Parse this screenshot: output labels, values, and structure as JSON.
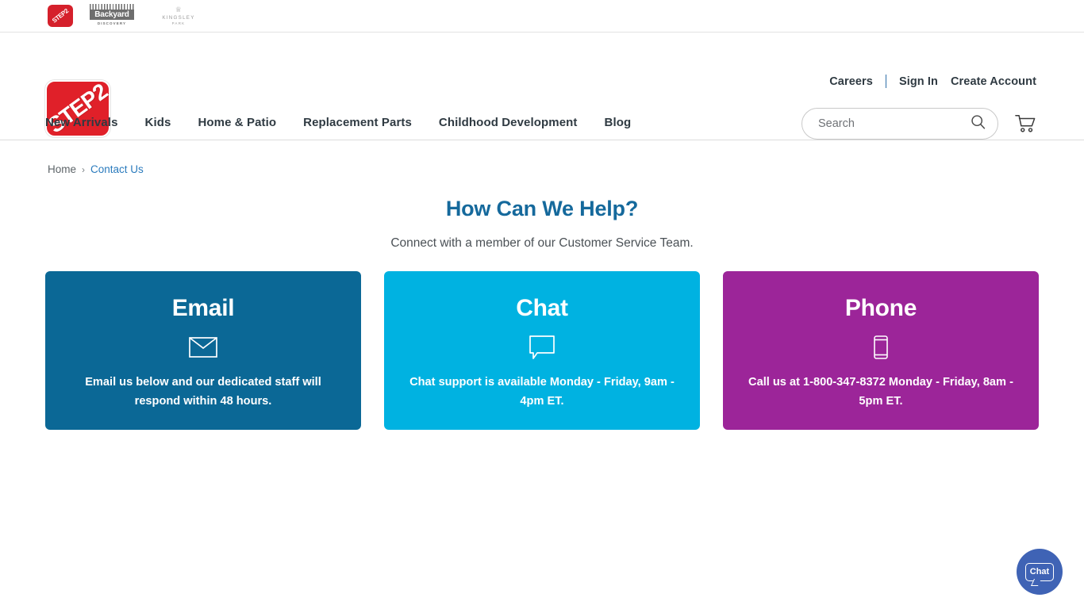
{
  "brandbar": {
    "logos": [
      {
        "name": "step2",
        "text": "STEP2"
      },
      {
        "name": "backyard-discovery",
        "text": "Backyard",
        "sub": "DISCOVERY"
      },
      {
        "name": "kingsley-park",
        "crown": "♕",
        "text": "KINGSLEY",
        "sub": "PARK"
      }
    ]
  },
  "header": {
    "logo_text": "STEP2",
    "utility_links": [
      {
        "label": "Careers"
      },
      {
        "label": "Sign In"
      },
      {
        "label": "Create Account"
      }
    ],
    "search": {
      "placeholder": "Search",
      "value": "",
      "icon": "search-icon"
    },
    "cart": {
      "icon": "shopping-cart-icon"
    },
    "nav": [
      {
        "label": "New Arrivals"
      },
      {
        "label": "Kids"
      },
      {
        "label": "Home & Patio"
      },
      {
        "label": "Replacement Parts"
      },
      {
        "label": "Childhood Development"
      },
      {
        "label": "Blog"
      }
    ]
  },
  "breadcrumb": {
    "home": "Home",
    "separator": "›",
    "current": "Contact Us"
  },
  "hero": {
    "title": "How Can We Help?",
    "subtitle": "Connect with a member of our Customer Service Team."
  },
  "cards": [
    {
      "id": "email",
      "title": "Email",
      "icon": "envelope-icon",
      "body": "Email us below and our dedicated staff will respond within 48 hours.",
      "color": "#0b6896"
    },
    {
      "id": "chat",
      "title": "Chat",
      "icon": "speech-bubble-icon",
      "body": "Chat support is available Monday - Friday, 9am - 4pm ET.",
      "color": "#00b2e1"
    },
    {
      "id": "phone",
      "title": "Phone",
      "icon": "mobile-phone-icon",
      "body": "Call us at 1-800-347-8372 Monday - Friday, 8am - 5pm ET.",
      "color": "#9c2599"
    }
  ],
  "chat_widget": {
    "label": "Chat",
    "color": "#3f63b5"
  }
}
